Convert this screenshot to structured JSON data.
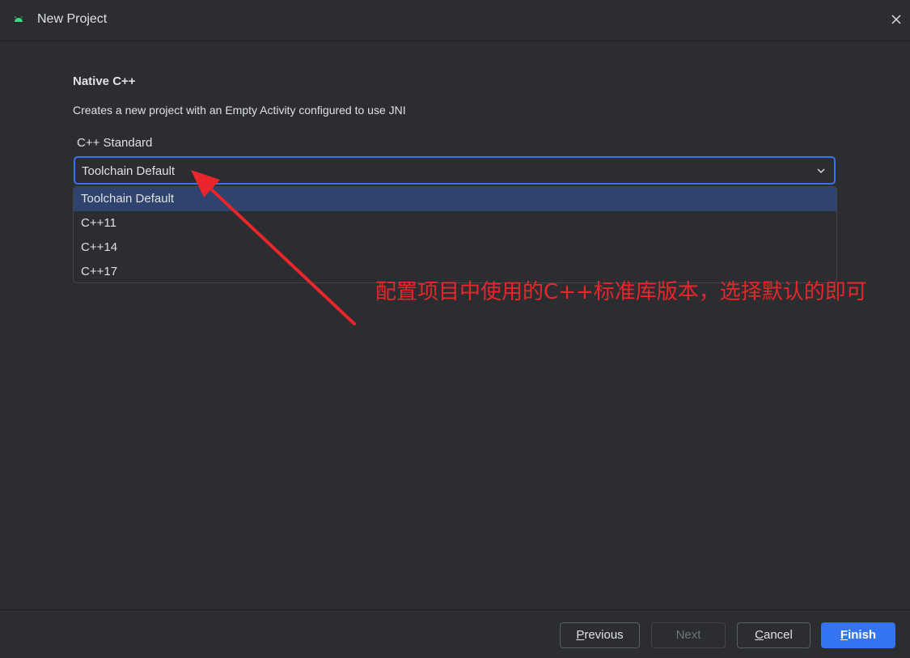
{
  "window": {
    "title": "New Project",
    "icon": "android-icon",
    "close_icon": "close-icon"
  },
  "template": {
    "heading": "Native C++",
    "description": "Creates a new project with an Empty Activity configured to use JNI"
  },
  "cpp_standard": {
    "label": "C++ Standard",
    "selected": "Toolchain Default",
    "options": [
      "Toolchain Default",
      "C++11",
      "C++14",
      "C++17"
    ],
    "highlighted_index": 0
  },
  "annotation": {
    "text": "配置项目中使用的C++标准库版本，选择默认的即可",
    "color": "#e8262b"
  },
  "footer": {
    "previous": {
      "first": "P",
      "rest": "revious"
    },
    "next": "Next",
    "cancel": {
      "first": "C",
      "rest": "ancel"
    },
    "finish": {
      "first": "F",
      "rest": "inish"
    }
  },
  "colors": {
    "background": "#2b2d30",
    "accent": "#3574f0",
    "selection": "#2e436e"
  }
}
